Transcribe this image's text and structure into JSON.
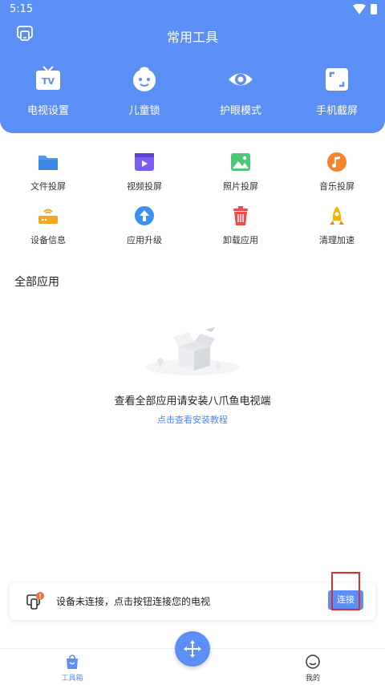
{
  "status_bar": {
    "time": "5:15"
  },
  "header": {
    "title": "常用工具",
    "top_tools": [
      {
        "label": "电视设置",
        "icon": "tv-icon"
      },
      {
        "label": "儿童锁",
        "icon": "child-face-icon"
      },
      {
        "label": "护眼模式",
        "icon": "eye-icon"
      },
      {
        "label": "手机截屏",
        "icon": "screenshot-icon"
      }
    ]
  },
  "tools": [
    {
      "label": "文件投屏",
      "icon": "folder-icon"
    },
    {
      "label": "视频投屏",
      "icon": "video-icon"
    },
    {
      "label": "照片投屏",
      "icon": "photo-icon"
    },
    {
      "label": "音乐投屏",
      "icon": "music-icon"
    },
    {
      "label": "设备信息",
      "icon": "router-icon"
    },
    {
      "label": "应用升级",
      "icon": "upgrade-icon"
    },
    {
      "label": "卸载应用",
      "icon": "trash-icon"
    },
    {
      "label": "清理加速",
      "icon": "rocket-icon"
    }
  ],
  "all_apps": {
    "title": "全部应用",
    "empty_text": "查看全部应用请安装八爪鱼电视端",
    "link": "点击查看安装教程"
  },
  "connect_banner": {
    "message": "设备未连接，点击按钮连接您的电视",
    "button": "连接"
  },
  "bottom_nav": {
    "tools_label": "工具箱",
    "mine_label": "我的"
  },
  "colors": {
    "accent": "#5b8ff6",
    "link": "#4a86f5",
    "highlight": "#e12a2a"
  }
}
